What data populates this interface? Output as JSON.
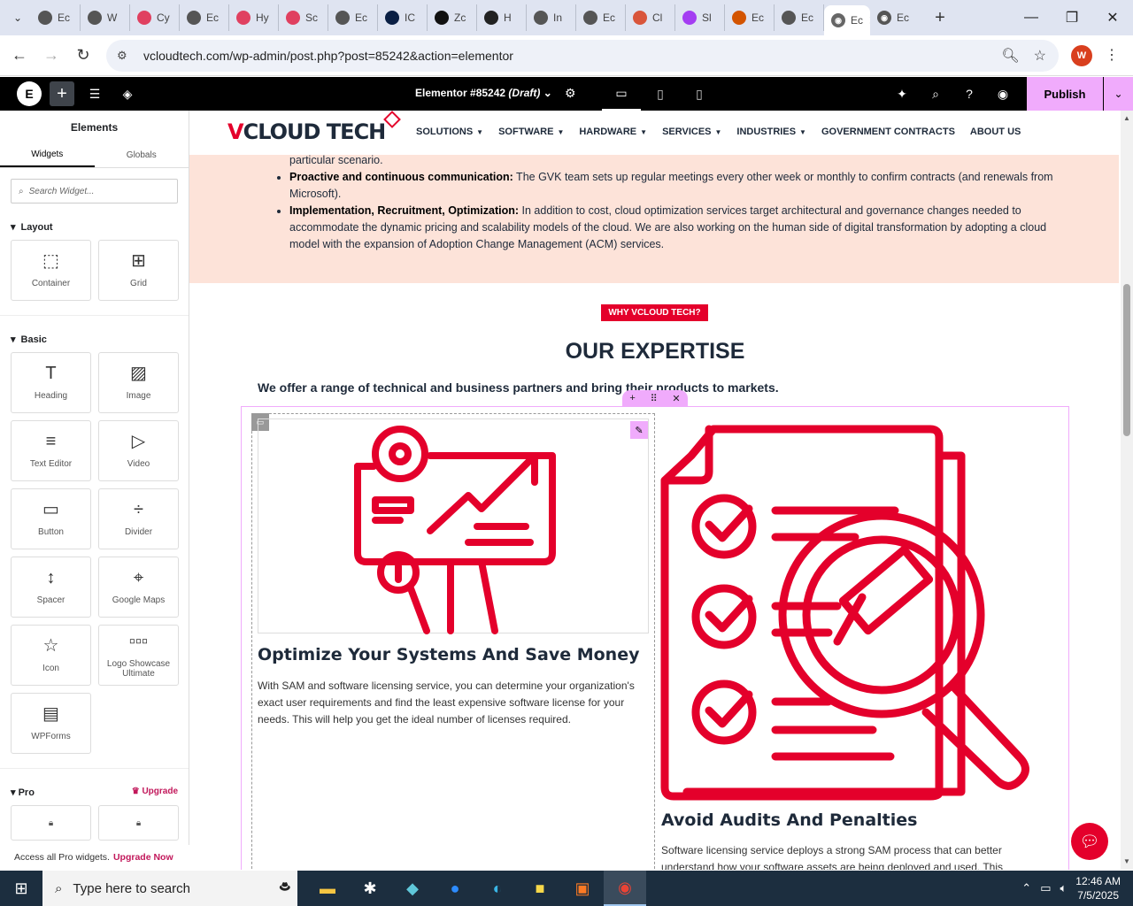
{
  "browser": {
    "tabs": [
      {
        "label": "Ec",
        "icon": "globe-icon"
      },
      {
        "label": "W",
        "icon": "globe-icon"
      },
      {
        "label": "Cy",
        "icon": "diamond-icon"
      },
      {
        "label": "Ec",
        "icon": "globe-icon"
      },
      {
        "label": "Hy",
        "icon": "diamond-icon"
      },
      {
        "label": "Sc",
        "icon": "diamond-icon"
      },
      {
        "label": "Ec",
        "icon": "globe-icon"
      },
      {
        "label": "IC",
        "icon": "n-icon"
      },
      {
        "label": "Zc",
        "icon": "z-icon"
      },
      {
        "label": "H",
        "icon": "openai-icon"
      },
      {
        "label": "In",
        "icon": "globe-icon"
      },
      {
        "label": "Ec",
        "icon": "globe-icon"
      },
      {
        "label": "Cl",
        "icon": "claude-icon"
      },
      {
        "label": "Sl",
        "icon": "circle-icon"
      },
      {
        "label": "Ec",
        "icon": "x-box-icon"
      },
      {
        "label": "Ec",
        "icon": "globe-icon"
      }
    ],
    "active_tab": {
      "label": "Ec"
    },
    "extra_tab": {
      "label": "Ec"
    },
    "url": "vcloudtech.com/wp-admin/post.php?post=85242&action=elementor",
    "profile_initial": "W"
  },
  "editor": {
    "doc_title": "Elementor #85242",
    "doc_status": "(Draft)",
    "publish_label": "Publish"
  },
  "panel": {
    "title": "Elements",
    "tab_widgets": "Widgets",
    "tab_globals": "Globals",
    "search_placeholder": "Search Widget...",
    "layout_label": "Layout",
    "basic_label": "Basic",
    "pro_label": "Pro",
    "upgrade_label": "Upgrade",
    "layout_widgets": [
      {
        "label": "Container",
        "icon": "container-icon"
      },
      {
        "label": "Grid",
        "icon": "grid-icon"
      }
    ],
    "basic_widgets": [
      {
        "label": "Heading",
        "icon": "heading-icon"
      },
      {
        "label": "Image",
        "icon": "image-icon"
      },
      {
        "label": "Text Editor",
        "icon": "text-editor-icon"
      },
      {
        "label": "Video",
        "icon": "video-icon"
      },
      {
        "label": "Button",
        "icon": "button-icon"
      },
      {
        "label": "Divider",
        "icon": "divider-icon"
      },
      {
        "label": "Spacer",
        "icon": "spacer-icon"
      },
      {
        "label": "Google Maps",
        "icon": "map-icon"
      },
      {
        "label": "Icon",
        "icon": "star-icon"
      },
      {
        "label": "Logo Showcase Ultimate",
        "icon": "logo-showcase-icon"
      },
      {
        "label": "WPForms",
        "icon": "form-icon"
      }
    ],
    "pro_bar_text": "Access all Pro widgets.",
    "pro_bar_link": "Upgrade Now"
  },
  "site": {
    "logo_v": "V",
    "logo_rest": "CLOUD TECH",
    "menu": [
      {
        "label": "SOLUTIONS",
        "dropdown": true
      },
      {
        "label": "SOFTWARE",
        "dropdown": true
      },
      {
        "label": "HARDWARE",
        "dropdown": true
      },
      {
        "label": "SERVICES",
        "dropdown": true
      },
      {
        "label": "INDUSTRIES",
        "dropdown": true
      },
      {
        "label": "GOVERNMENT CONTRACTS",
        "dropdown": false
      },
      {
        "label": "ABOUT US",
        "dropdown": false
      }
    ],
    "bullet_fragment": "particular scenario.",
    "bullets": [
      {
        "bold": "Proactive and continuous communication:",
        "text": " The GVK team sets up regular meetings every other week or monthly to confirm contracts (and renewals from Microsoft)."
      },
      {
        "bold": "Implementation, Recruitment, Optimization:",
        "text": " In addition to cost, cloud optimization services target architectural and governance changes needed to accommodate the dynamic pricing and scalability models of the cloud. We are also working on the human side of digital transformation by adopting a cloud model with the expansion of Adoption Change Management (ACM) services."
      }
    ],
    "badge": "WHY VCLOUD TECH?",
    "expertise_title": "OUR EXPERTISE",
    "expertise_sub": "We offer a range of technical and business partners and bring their products to markets.",
    "card1_title": "Optimize Your Systems And Save Money",
    "card1_text": "With SAM and software licensing service, you can determine your organization's exact user requirements and find the least expensive software license for your needs. This will help you get the ideal number of licenses required.",
    "card2_title": "Avoid Audits And Penalties",
    "card2_text": "Software licensing service deploys a strong SAM process that can better understand how your software assets are being deployed and used. This"
  },
  "taskbar": {
    "search_placeholder": "Type here to search",
    "time": "12:46 AM",
    "date": "7/5/2025"
  },
  "colors": {
    "brand_red": "#e4002b",
    "navy": "#1e2a3a",
    "elementor_pink": "#f0abfc",
    "peach": "#fde3d9"
  }
}
